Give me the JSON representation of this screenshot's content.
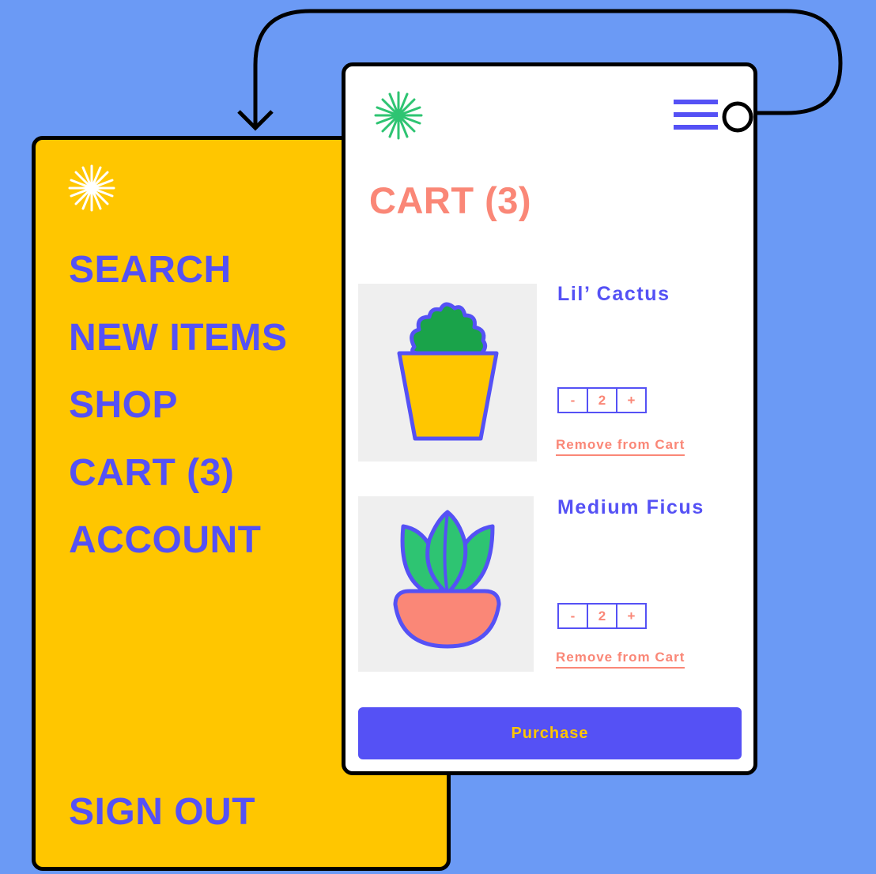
{
  "menu": {
    "items": [
      "SEARCH",
      "NEW ITEMS",
      "SHOP",
      "CART (3)",
      "ACCOUNT"
    ],
    "sign_out": "SIGN OUT"
  },
  "cart": {
    "title": "CART (3)",
    "items": [
      {
        "name": "Lil’ Cactus",
        "quantity": "2",
        "decrement": "-",
        "increment": "+",
        "remove": "Remove from Cart"
      },
      {
        "name": "Medium Ficus",
        "quantity": "2",
        "decrement": "-",
        "increment": "+",
        "remove": "Remove from Cart"
      }
    ],
    "purchase_label": "Purchase"
  },
  "colors": {
    "background": "#6b9af5",
    "menu_panel": "#ffc600",
    "accent_blue": "#5551f5",
    "accent_coral": "#fa8777",
    "logo_green": "#2ec472"
  },
  "icons": [
    "starburst-logo-icon",
    "hamburger-menu-icon",
    "cactus-illustration",
    "ficus-illustration",
    "flow-arrow"
  ]
}
